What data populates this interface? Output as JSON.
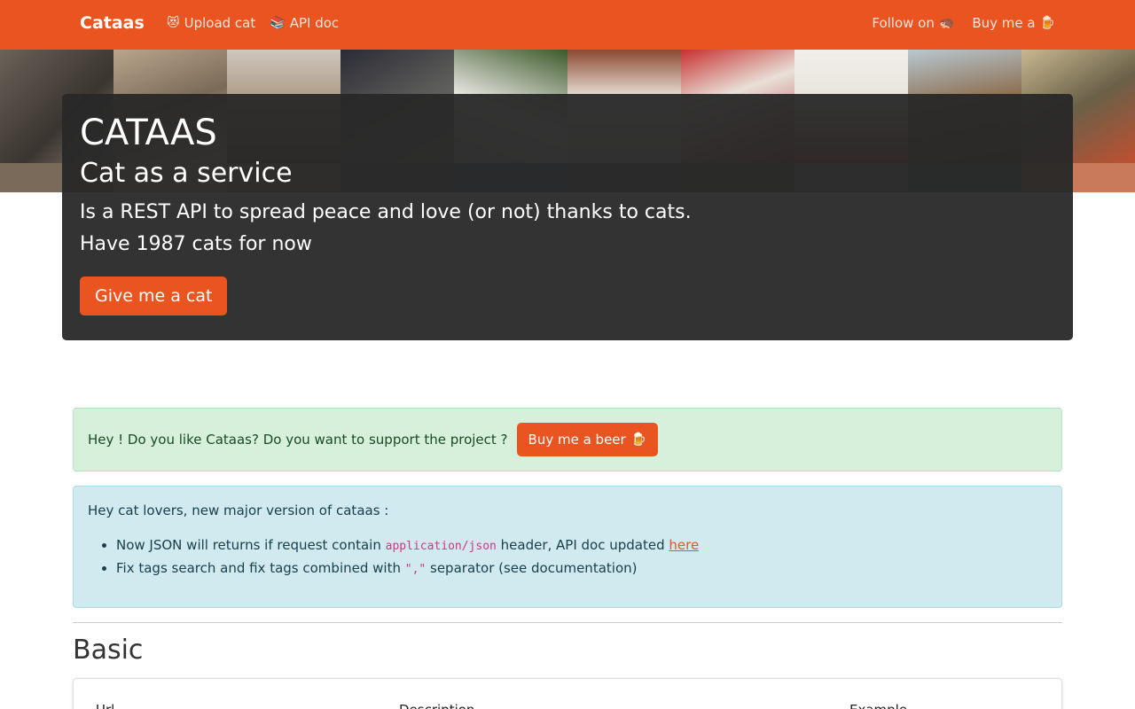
{
  "navbar": {
    "brand": "Cataas",
    "links_left": [
      {
        "icon": "heart-eyes-cat-icon",
        "label": "Upload cat"
      },
      {
        "icon": "books-icon",
        "label": "API doc"
      }
    ],
    "links_right": [
      {
        "label": "Follow on",
        "icon": "hedgehog-icon"
      },
      {
        "label": "Buy me a",
        "icon": "beer-icon"
      }
    ],
    "color": "#e95420"
  },
  "hero": {
    "title": "CATAAS",
    "subtitle": "Cat as a service",
    "line1": "Is a REST API to spread peace and love (or not) thanks to cats.",
    "line2": "Have 1987 cats for now",
    "button": "Give me a cat"
  },
  "support_alert": {
    "text": "Hey ! Do you like Cataas? Do you want to support the project ?",
    "button": "Buy me a beer"
  },
  "info_alert": {
    "intro": "Hey cat lovers, new major version of cataas :",
    "item1_a": "Now JSON will returns if request contain",
    "item1_code": "application/json",
    "item1_b": "header, API doc updated",
    "item1_link": "here",
    "item2_a": "Fix tags search and fix tags combined with",
    "item2_code": "\",\"",
    "item2_b": "separator (see documentation)"
  },
  "section": {
    "title": "Basic",
    "columns": [
      "Url",
      "Description",
      "Example"
    ]
  }
}
